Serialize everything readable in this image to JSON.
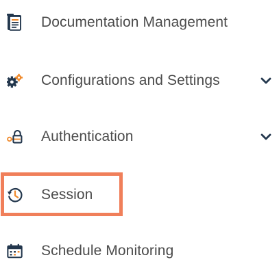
{
  "menu": {
    "items": [
      {
        "label": "Documentation Management",
        "icon": "document-management-icon",
        "has_submenu": false
      },
      {
        "label": "Configurations and Settings",
        "icon": "gears-icon",
        "has_submenu": true
      },
      {
        "label": "Authentication",
        "icon": "key-lock-icon",
        "has_submenu": true
      },
      {
        "label": "Session",
        "icon": "clock-history-icon",
        "has_submenu": false
      },
      {
        "label": "Schedule Monitoring",
        "icon": "calendar-icon",
        "has_submenu": false
      }
    ],
    "highlighted_item": "Session"
  },
  "colors": {
    "icon_dark": "#23374d",
    "icon_orange": "#f08a2c",
    "highlight_border": "#f07f5a",
    "text": "#4b4b4b"
  }
}
